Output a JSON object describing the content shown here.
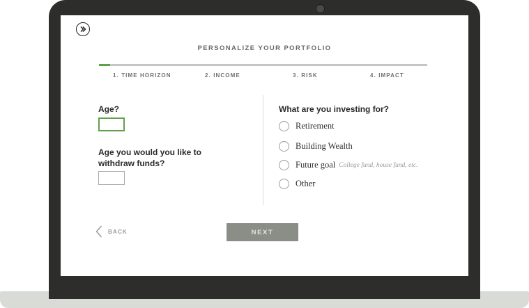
{
  "header": {
    "title": "PERSONALIZE YOUR PORTFOLIO",
    "logo_icon": "double-chevron-right-icon"
  },
  "progress": {
    "fraction": 0.035,
    "fill_color": "#5fa04a",
    "steps": [
      {
        "label": "1. TIME HORIZON"
      },
      {
        "label": "2. INCOME"
      },
      {
        "label": "3. RISK"
      },
      {
        "label": "4. IMPACT"
      }
    ]
  },
  "form": {
    "age": {
      "label": "Age?",
      "value": ""
    },
    "withdraw": {
      "label_line1": "Age you would you like to",
      "label_line2": "withdraw funds?",
      "value": ""
    },
    "investing": {
      "label": "What are you investing for?",
      "options": [
        {
          "label": "Retirement",
          "hint": ""
        },
        {
          "label": "Building Wealth",
          "hint": ""
        },
        {
          "label": "Future goal",
          "hint": "College fund, house fund, etc."
        },
        {
          "label": "Other",
          "hint": ""
        }
      ]
    }
  },
  "footer": {
    "back_label": "BACK",
    "back_icon": "chevron-left-icon",
    "next_label": "NEXT"
  }
}
